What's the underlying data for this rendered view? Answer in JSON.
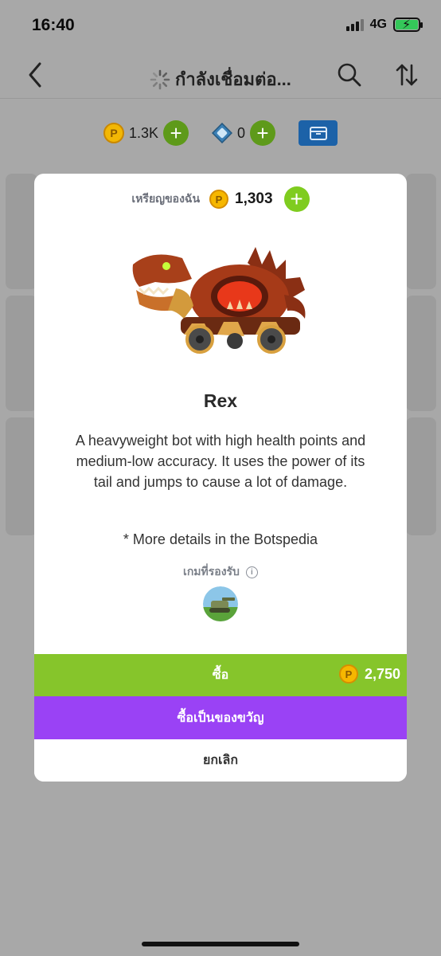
{
  "status": {
    "time": "16:40",
    "network": "4G"
  },
  "nav": {
    "title": "กำลังเชื่อมต่อ..."
  },
  "wallet": {
    "coins": "1.3K",
    "gems": "0"
  },
  "modal": {
    "my_coins_label": "เหรียญของฉัน",
    "my_coins_value": "1,303",
    "bot_name": "Rex",
    "bot_description": "A heavyweight bot with high health points and medium-low accuracy. It uses the power of its tail and jumps to cause a lot of damage.",
    "bot_note": "* More details in the Botspedia",
    "supported_games_label": "เกมที่รองรับ",
    "buy_label": "ซื้อ",
    "buy_price": "2,750",
    "gift_label": "ซื้อเป็นของขวัญ",
    "cancel_label": "ยกเลิก"
  },
  "colors": {
    "buy": "#86c52b",
    "gift": "#9a42f5",
    "coin": "#f6b700",
    "add": "#7fcc1f"
  }
}
